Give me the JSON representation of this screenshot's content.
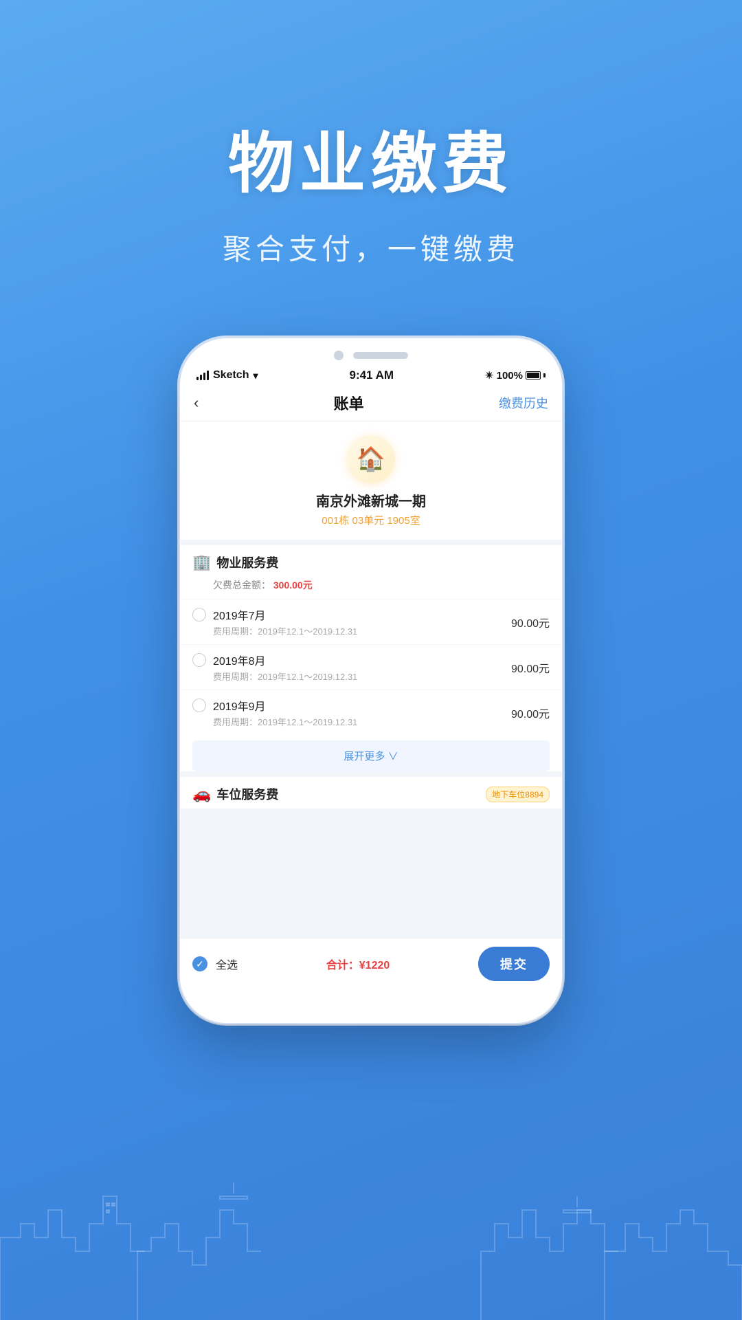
{
  "hero": {
    "title": "物业缴费",
    "subtitle": "聚合支付，一键缴费"
  },
  "status_bar": {
    "carrier": "Sketch",
    "time": "9:41 AM",
    "battery": "100%"
  },
  "navbar": {
    "back_label": "‹",
    "title": "账单",
    "action": "缴费历史"
  },
  "property": {
    "name": "南京外滩新城一期",
    "address": "001栋 03单元 1905室"
  },
  "fee_sections": [
    {
      "id": "property_fee",
      "icon": "🏢",
      "title": "物业服务费",
      "badge": null,
      "owed_label": "欠费总金额：",
      "owed_amount": "300.00元",
      "items": [
        {
          "month": "2019年7月",
          "period": "费用周期：2019年12.1～2019.12.31",
          "price": "90.00元"
        },
        {
          "month": "2019年8月",
          "period": "费用周期：2019年12.1～2019.12.31",
          "price": "90.00元"
        },
        {
          "month": "2019年9月",
          "period": "费用周期：2019年12.1～2019.12.31",
          "price": "90.00元"
        }
      ],
      "expand_label": "展开更多 ∨"
    },
    {
      "id": "parking_fee",
      "icon": "🚗",
      "title": "车位服务费",
      "badge": "地下车位8894",
      "owed_label": null,
      "owed_amount": null,
      "items": []
    }
  ],
  "bottom_bar": {
    "select_all": "全选",
    "total_label": "合计：",
    "total_amount": "¥1220",
    "submit_label": "提交"
  }
}
